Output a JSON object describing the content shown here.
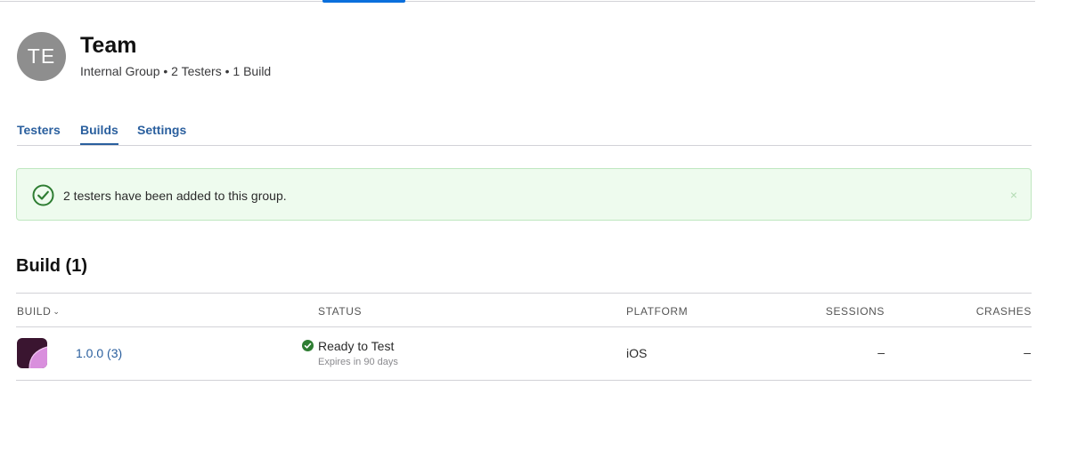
{
  "header": {
    "avatar_initials": "TE",
    "title": "Team",
    "meta": "Internal Group • 2 Testers • 1 Build"
  },
  "tabs": [
    {
      "label": "Testers",
      "active": false
    },
    {
      "label": "Builds",
      "active": true
    },
    {
      "label": "Settings",
      "active": false
    }
  ],
  "banner": {
    "message": "2 testers have been added to this group.",
    "close_symbol": "×",
    "icon": "check-circle-icon"
  },
  "section": {
    "title": "Build (1)"
  },
  "table": {
    "columns": {
      "build": "BUILD",
      "status": "STATUS",
      "platform": "PLATFORM",
      "sessions": "SESSIONS",
      "crashes": "CRASHES"
    },
    "sort_symbol": "⌄",
    "rows": [
      {
        "build": "1.0.0 (3)",
        "status": "Ready to Test",
        "status_detail": "Expires in 90 days",
        "platform": "iOS",
        "sessions": "–",
        "crashes": "–"
      }
    ]
  },
  "colors": {
    "accent": "#2a5f9e",
    "success": "#2e7d32",
    "banner_bg": "#eefbee"
  }
}
